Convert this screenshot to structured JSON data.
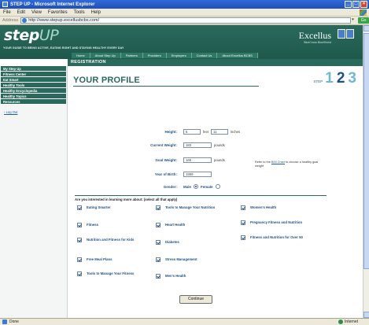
{
  "window": {
    "title": "STEP UP - Microsoft Internet Explorer"
  },
  "menu": [
    "File",
    "Edit",
    "View",
    "Favorites",
    "Tools",
    "Help"
  ],
  "address": {
    "label": "Address",
    "url": "http://www.stepup.excellusbcbs.com/",
    "go": "Go"
  },
  "site": {
    "logo_main": "step",
    "logo_up": "UP",
    "tagline": "YOUR GUIDE TO BEING ACTIVE, EATING RIGHT AND STAYING HEALTHY EVERY DAY",
    "brand": "Excellus",
    "brand_sub": "BlueCross BlueShield",
    "nav": [
      "Home",
      "About Step Up",
      "Partners",
      "Providers",
      "Employers",
      "Contact Us",
      "About Excellus BCBS"
    ],
    "section": "REGISTRATION"
  },
  "sidebar": {
    "items": [
      "My Step Up",
      "Fitness Center",
      "Eat Smart",
      "Healthy Tools",
      "Healthy Encyclopedia",
      "Healthy Topics",
      "Resources"
    ],
    "logout": "Log Out"
  },
  "profile": {
    "title": "YOUR PROFILE",
    "step_label": "STEP",
    "steps": [
      "1",
      "2",
      "3"
    ],
    "height_label": "Height:",
    "height_feet": "5",
    "feet_unit": "feet",
    "height_inches": "11",
    "inches_unit": "inches",
    "current_weight_label": "Current Weight:",
    "current_weight": "183",
    "pounds_unit": "pounds",
    "goal_weight_label": "Goal Weight:",
    "goal_weight": "165",
    "pounds_unit2": "pounds",
    "note_prefix": "Refer to the",
    "note_link": "BMI Chart",
    "note_suffix": "to choose a healthy goal weight",
    "birth_label": "Year of Birth:",
    "birth_year": "1959",
    "gender_label": "Gender:",
    "male": "Male",
    "female": "Female",
    "interest_question": "Are you interested in learning more about: (select all that apply)",
    "interests": [
      "Eating Smarter",
      "Tools to Manage Your Nutrition",
      "Women's Health",
      "Fitness",
      "Heart Health",
      "Pregnancy Fitness and Nutrition",
      "Nutrition and Fitness for Kids",
      "Diabetes",
      "Fitness and Nutrition for Over 50",
      "Free Meal Plans",
      "Stress Management",
      "",
      "Tools to Manage Your Fitness",
      "Men's Health",
      ""
    ],
    "continue": "Continue"
  },
  "status": {
    "left": "Done",
    "zone": "Internet"
  }
}
